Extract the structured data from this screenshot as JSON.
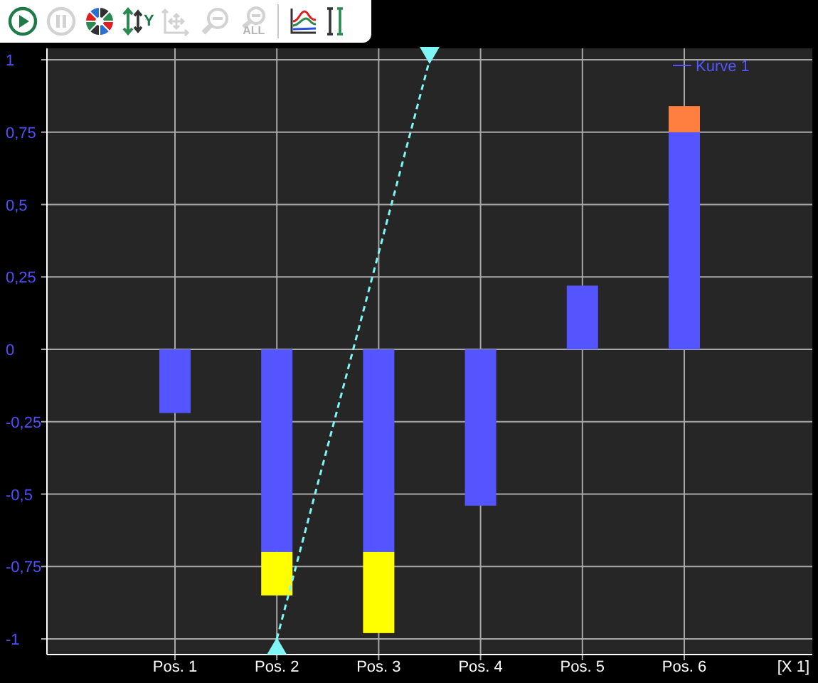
{
  "toolbar": {
    "items": [
      {
        "kind": "play",
        "disabled": false
      },
      {
        "kind": "pause",
        "disabled": true
      },
      {
        "kind": "colors",
        "disabled": false
      },
      {
        "kind": "yscale",
        "label": "Y",
        "disabled": false
      },
      {
        "kind": "move",
        "disabled": true
      },
      {
        "kind": "zoomout",
        "disabled": true
      },
      {
        "kind": "zoomall",
        "label": "ALL",
        "disabled": true
      },
      {
        "kind": "curves",
        "disabled": false
      },
      {
        "kind": "cursor",
        "disabled": false
      }
    ]
  },
  "chart": {
    "chart_data": {
      "type": "bar",
      "stacked": true,
      "categories": [
        "Pos. 1",
        "Pos. 2",
        "Pos. 3",
        "Pos. 4",
        "Pos. 5",
        "Pos. 6"
      ],
      "series": [
        {
          "name": "Kurve 1",
          "color": "#5555ff",
          "values": [
            -0.22,
            -0.7,
            -0.7,
            -0.54,
            0.22,
            0.75
          ]
        },
        {
          "color": "#ffff00",
          "values": [
            null,
            -0.15,
            -0.28,
            null,
            null,
            null
          ]
        },
        {
          "color": "#ff7f40",
          "values": [
            null,
            null,
            null,
            null,
            null,
            0.09
          ]
        }
      ],
      "ylim": [
        -1,
        1
      ],
      "yticks": [
        {
          "value": 1,
          "label": "1"
        },
        {
          "value": 0.75,
          "label": "0,75"
        },
        {
          "value": 0.5,
          "label": "0,5"
        },
        {
          "value": 0.25,
          "label": "0,25"
        },
        {
          "value": 0,
          "label": "0"
        },
        {
          "value": -0.25,
          "label": "-0,25"
        },
        {
          "value": -0.5,
          "label": "-0,5"
        },
        {
          "value": -0.75,
          "label": "-0,75"
        },
        {
          "value": -1,
          "label": "-1"
        }
      ],
      "xlabel": "[X 1]",
      "grid": true
    }
  }
}
